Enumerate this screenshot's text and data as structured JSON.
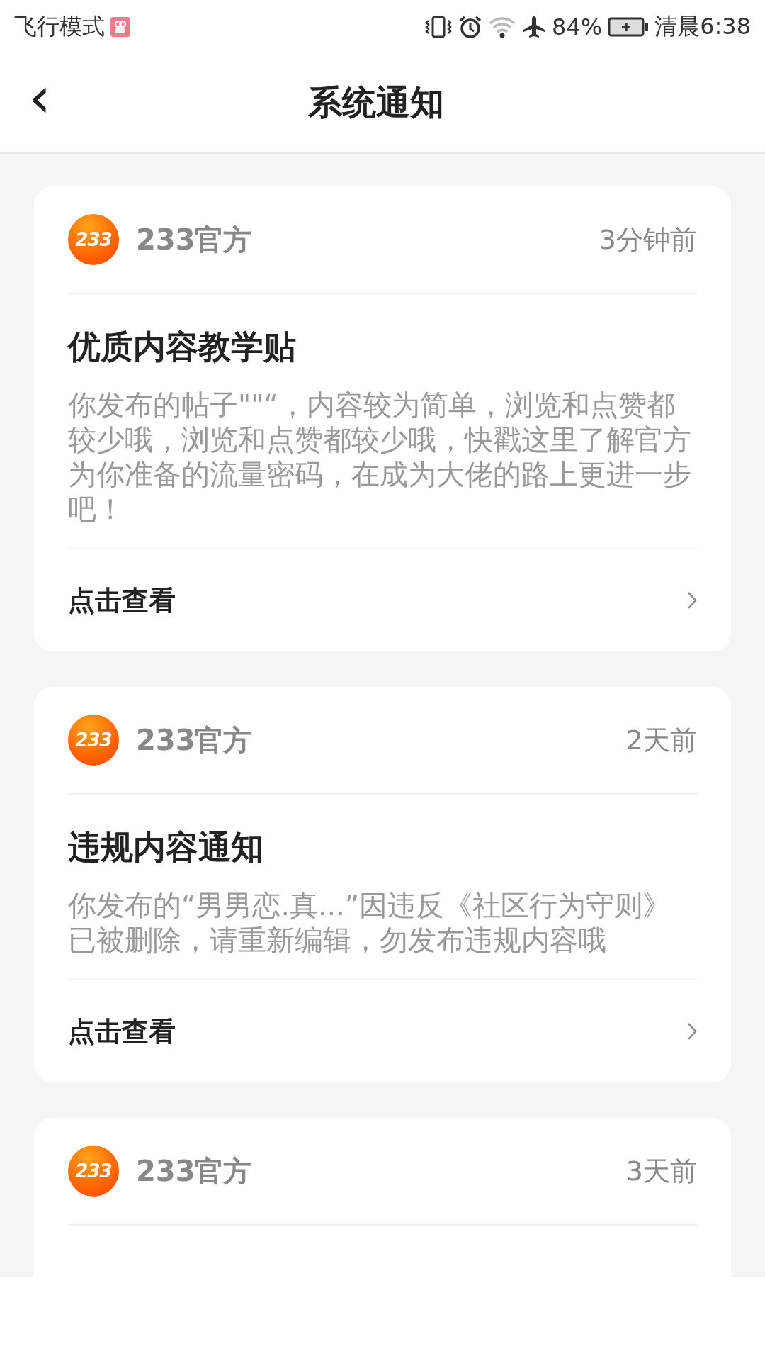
{
  "status_bar": {
    "mode": "飞行模式",
    "battery_percent": "84%",
    "time": "清晨6:38"
  },
  "header": {
    "back": "‹",
    "title": "系统通知"
  },
  "notifications": [
    {
      "logo_text": "233",
      "sender": "233官方",
      "time": "3分钟前",
      "title": "优质内容教学贴",
      "body": "你发布的帖子\"\"“，内容较为简单，浏览和点赞都较少哦，浏览和点赞都较少哦，快戳这里了解官方为你准备的流量密码，在成为大佬的路上更进一步吧！",
      "action": "点击查看"
    },
    {
      "logo_text": "233",
      "sender": "233官方",
      "time": "2天前",
      "title": "违规内容通知",
      "body": "你发布的“男男恋.真...”因违反《社区行为守则》已被删除，请重新编辑，勿发布违规内容哦",
      "action": "点击查看"
    },
    {
      "logo_text": "233",
      "sender": "233官方",
      "time": "3天前"
    }
  ]
}
